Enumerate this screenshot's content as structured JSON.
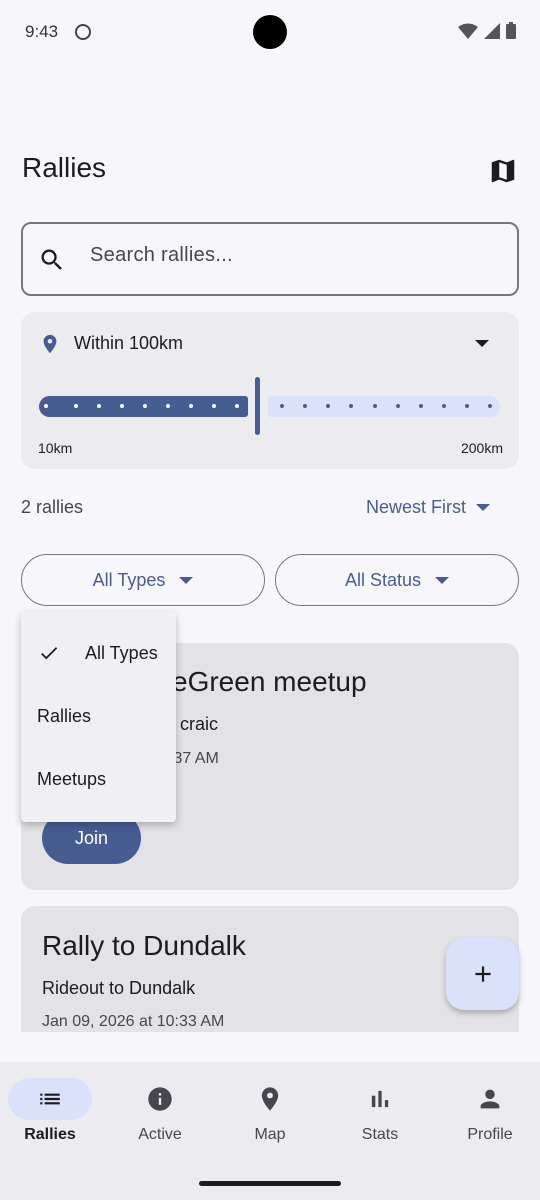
{
  "status_bar": {
    "time": "9:43"
  },
  "header": {
    "title": "Rallies"
  },
  "search": {
    "placeholder": "Search rallies..."
  },
  "distance": {
    "label": "Within 100km",
    "min_label": "10km",
    "max_label": "200km",
    "value_km": 100,
    "range_km": [
      10,
      200
    ]
  },
  "list": {
    "count": "2 rallies",
    "sort_label": "Newest First"
  },
  "filters": {
    "types_label": "All Types",
    "status_label": "All Status"
  },
  "types_menu": {
    "items": [
      {
        "label": "All Types",
        "selected": true
      },
      {
        "label": "Rallies",
        "selected": false
      },
      {
        "label": "Meetups",
        "selected": false
      }
    ]
  },
  "cards": [
    {
      "title_visible": "eGreen meetup",
      "subtitle_visible": "craic",
      "date_visible": ":37 AM",
      "action": "Join"
    },
    {
      "title": "Rally to Dundalk",
      "subtitle": "Rideout to Dundalk",
      "date": "Jan 09, 2026 at 10:33 AM"
    }
  ],
  "nav": {
    "items": [
      {
        "label": "Rallies",
        "icon": "list-icon",
        "active": true
      },
      {
        "label": "Active",
        "icon": "info-icon",
        "active": false
      },
      {
        "label": "Map",
        "icon": "pin-icon",
        "active": false
      },
      {
        "label": "Stats",
        "icon": "bar-chart-icon",
        "active": false
      },
      {
        "label": "Profile",
        "icon": "person-icon",
        "active": false
      }
    ]
  },
  "colors": {
    "primary": "#475d92",
    "primary_container": "#d9e2fa",
    "surface": "#f7f6fb",
    "card": "#e3e2e7"
  }
}
